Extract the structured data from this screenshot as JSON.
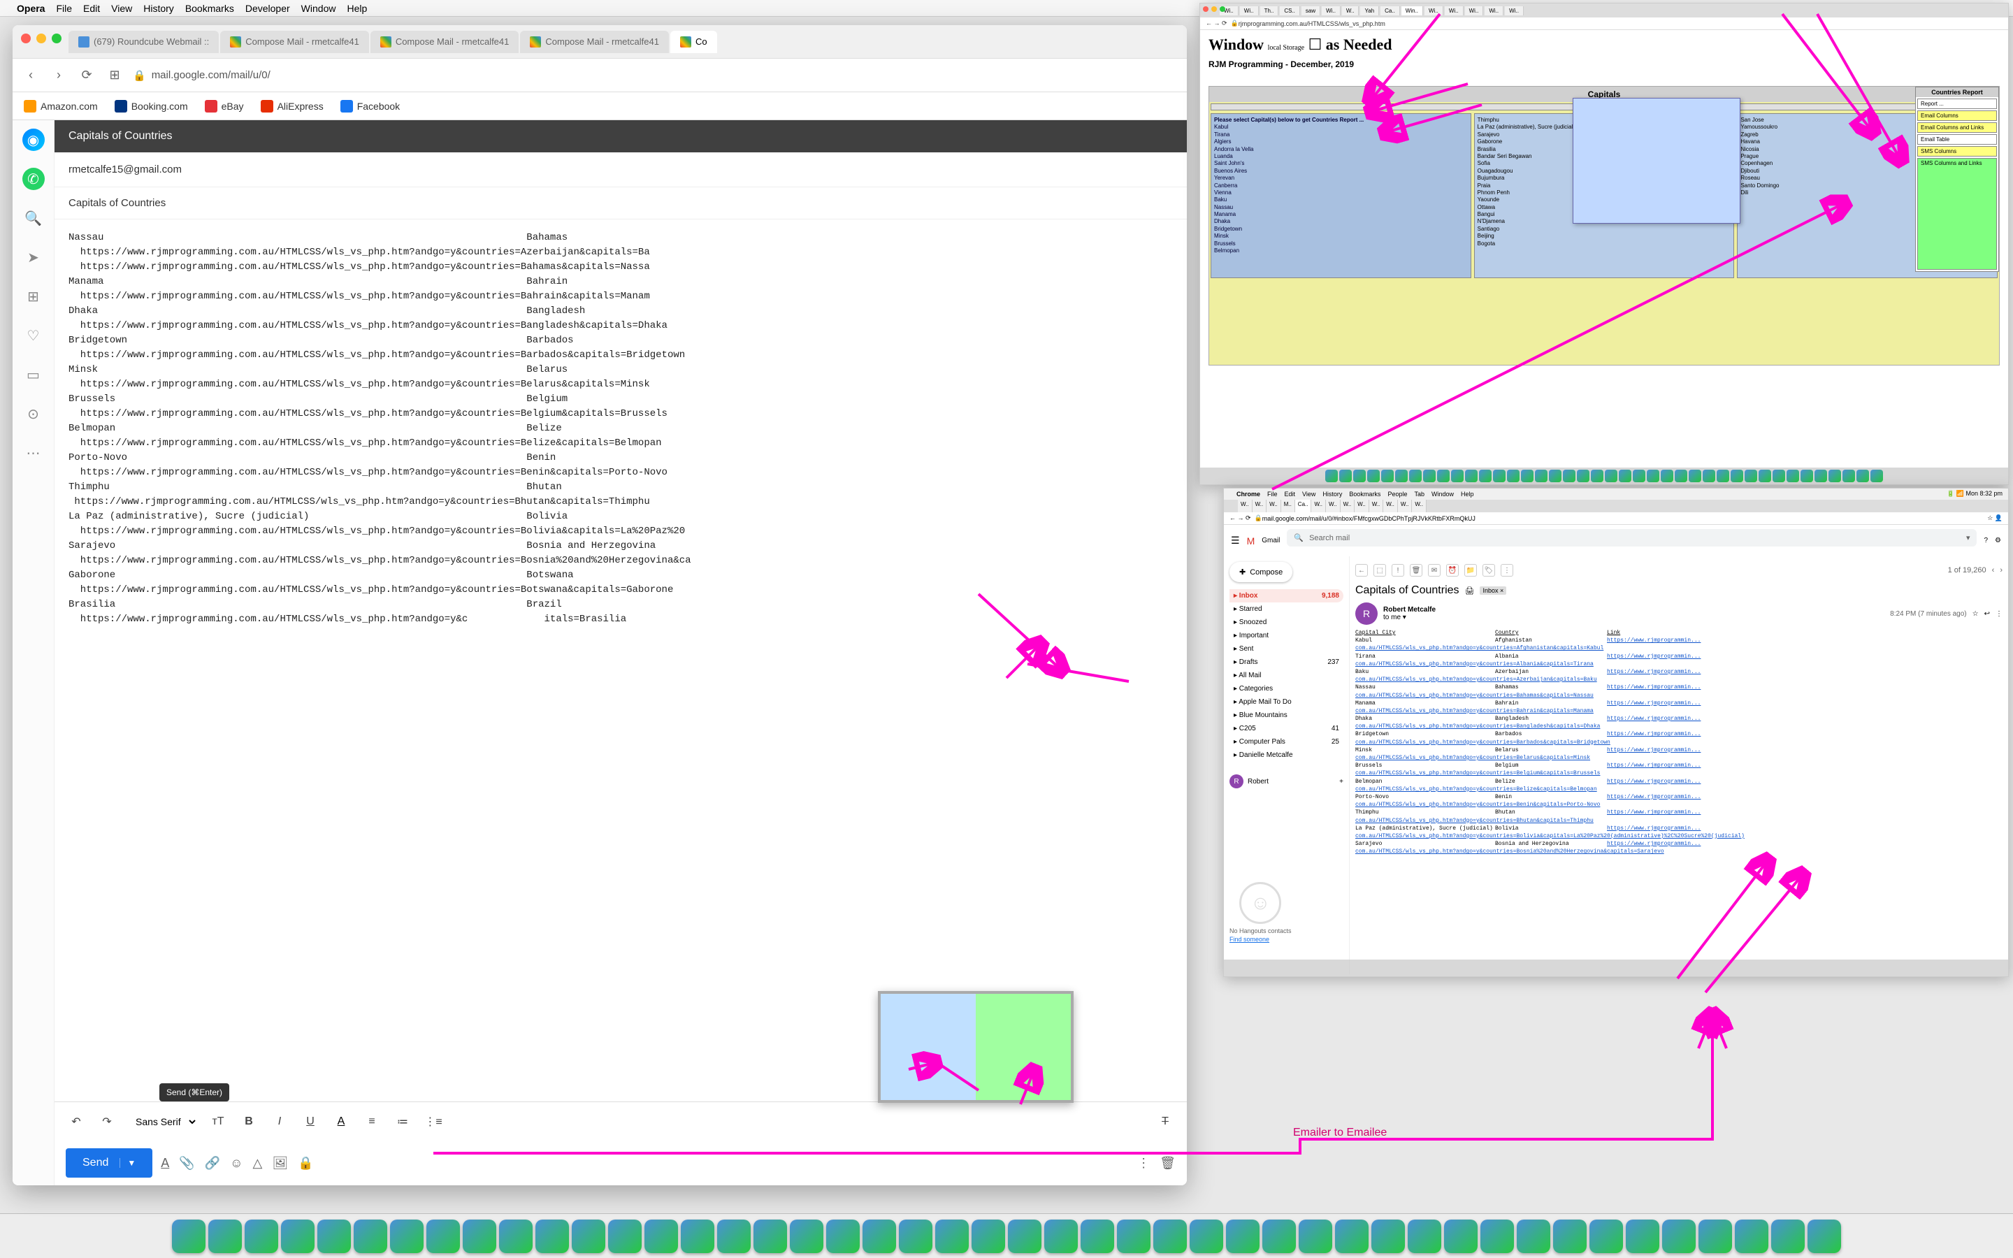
{
  "menubar": {
    "apple": "",
    "app": "Opera",
    "items": [
      "File",
      "Edit",
      "View",
      "History",
      "Bookmarks",
      "Developer",
      "Window",
      "Help"
    ]
  },
  "opera": {
    "tabs": [
      {
        "label": "(679) Roundcube Webmail ::",
        "type": "rc"
      },
      {
        "label": "Compose Mail - rmetcalfe41",
        "type": "gmail"
      },
      {
        "label": "Compose Mail - rmetcalfe41",
        "type": "gmail"
      },
      {
        "label": "Compose Mail - rmetcalfe41",
        "type": "gmail"
      },
      {
        "label": "Co",
        "type": "gmail"
      }
    ],
    "url": "mail.google.com/mail/u/0/",
    "bookmarks": [
      {
        "label": "Amazon.com",
        "color": "#ff9900"
      },
      {
        "label": "Booking.com",
        "color": "#003580"
      },
      {
        "label": "eBay",
        "color": "#e53238"
      },
      {
        "label": "AliExpress",
        "color": "#e62e04"
      },
      {
        "label": "Facebook",
        "color": "#1877f2"
      }
    ]
  },
  "compose": {
    "header": "Capitals of Countries",
    "to": "rmetcalfe15@gmail.com",
    "subject": "Capitals of Countries ",
    "body_lines": [
      "Nassau                                                                        Bahamas",
      "  https://www.rjmprogramming.com.au/HTMLCSS/wls_vs_php.htm?andgo=y&countries=Azerbaijan&capitals=Ba",
      "  https://www.rjmprogramming.com.au/HTMLCSS/wls_vs_php.htm?andgo=y&countries=Bahamas&capitals=Nassa",
      "Manama                                                                        Bahrain",
      "  https://www.rjmprogramming.com.au/HTMLCSS/wls_vs_php.htm?andgo=y&countries=Bahrain&capitals=Manam",
      "Dhaka                                                                         Bangladesh",
      "  https://www.rjmprogramming.com.au/HTMLCSS/wls_vs_php.htm?andgo=y&countries=Bangladesh&capitals=Dhaka",
      "Bridgetown                                                                    Barbados",
      "  https://www.rjmprogramming.com.au/HTMLCSS/wls_vs_php.htm?andgo=y&countries=Barbados&capitals=Bridgetown",
      "Minsk                                                                         Belarus",
      "  https://www.rjmprogramming.com.au/HTMLCSS/wls_vs_php.htm?andgo=y&countries=Belarus&capitals=Minsk",
      "Brussels                                                                      Belgium",
      "  https://www.rjmprogramming.com.au/HTMLCSS/wls_vs_php.htm?andgo=y&countries=Belgium&capitals=Brussels",
      "Belmopan                                                                      Belize",
      "  https://www.rjmprogramming.com.au/HTMLCSS/wls_vs_php.htm?andgo=y&countries=Belize&capitals=Belmopan",
      "Porto-Novo                                                                    Benin",
      "  https://www.rjmprogramming.com.au/HTMLCSS/wls_vs_php.htm?andgo=y&countries=Benin&capitals=Porto-Novo",
      "Thimphu                                                                       Bhutan",
      " https://www.rjmprogramming.com.au/HTMLCSS/wls_vs_php.htm?andgo=y&countries=Bhutan&capitals=Thimphu",
      "La Paz (administrative), Sucre (judicial)                                     Bolivia",
      "  https://www.rjmprogramming.com.au/HTMLCSS/wls_vs_php.htm?andgo=y&countries=Bolivia&capitals=La%20Paz%20",
      "Sarajevo                                                                      Bosnia and Herzegovina",
      "  https://www.rjmprogramming.com.au/HTMLCSS/wls_vs_php.htm?andgo=y&countries=Bosnia%20and%20Herzegovina&ca",
      "Gaborone                                                                      Botswana",
      "  https://www.rjmprogramming.com.au/HTMLCSS/wls_vs_php.htm?andgo=y&countries=Botswana&capitals=Gaborone",
      "Brasilia                                                                      Brazil",
      "  https://www.rjmprogramming.com.au/HTMLCSS/wls_vs_php.htm?andgo=y&c             itals=Brasilia"
    ],
    "font": "Sans Serif",
    "send": "Send",
    "tooltip": "Send (⌘Enter)"
  },
  "smallwin": {
    "url": "rjmprogramming.com.au/HTMLCSS/wls_vs_php.htm",
    "h1a": "Window ",
    "h1b": "local Storage",
    "h1c": " as Needed",
    "h2": "RJM Programming - December, 2019",
    "panel_title": "Capitals",
    "instr": "Please select Capital(s) below to get Countries Report ...",
    "col1": [
      "Kabul",
      "Tirana",
      "Algiers",
      "Andorra la Vella",
      "Luanda",
      "Saint John's",
      "Buenos Aires",
      "Yerevan",
      "Canberra",
      "Vienna",
      "Baku",
      "Nassau",
      "Manama",
      "Dhaka",
      "Bridgetown",
      "Minsk",
      "Brussels",
      "Belmopan"
    ],
    "col2": [
      "Thimphu",
      "La Paz (administrative), Sucre (judicial)",
      "Sarajevo",
      "Gaborone",
      "Brasilia",
      "Bandar Seri Begawan",
      "Sofia",
      "Ouagadougou",
      "Bujumbura",
      "Praia",
      "Phnom Penh",
      "Yaounde",
      "Ottawa",
      "Bangui",
      "N'Djamena",
      "Santiago",
      "Beijing",
      "Bogota"
    ],
    "col3": [
      "San Jose",
      "Yamoussoukro",
      "Zagreb",
      "Havana",
      "Nicosia",
      "Prague",
      "Copenhagen",
      "Djibouti",
      "Roseau",
      "Santo Domingo",
      "Dili"
    ],
    "report_title": "Countries Report",
    "report_btns": [
      "Report ...",
      "Email Columns",
      "Email Columns and Links",
      "Email Table",
      "SMS Columns",
      "SMS Columns and Links"
    ]
  },
  "chromewin": {
    "app": "Chrome",
    "menus": [
      "File",
      "Edit",
      "View",
      "History",
      "Bookmarks",
      "People",
      "Tab",
      "Window",
      "Help"
    ],
    "clock": "Mon 8:32 pm",
    "url": "mail.google.com/mail/u/0/#inbox/FMfcgxwGDbCPhTpjRJVkKRtbFXRmQkUJ",
    "gmail": "Gmail",
    "search_ph": "Search mail",
    "compose": "Compose",
    "folders": [
      {
        "label": "Inbox",
        "count": "9,188",
        "active": true
      },
      {
        "label": "Starred"
      },
      {
        "label": "Snoozed"
      },
      {
        "label": "Important"
      },
      {
        "label": "Sent"
      },
      {
        "label": "Drafts",
        "count": "237"
      },
      {
        "label": "All Mail"
      },
      {
        "label": "Categories"
      },
      {
        "label": "Apple Mail To Do"
      },
      {
        "label": "Blue Mountains"
      },
      {
        "label": "C205",
        "count": "41"
      },
      {
        "label": "Computer Pals",
        "count": "25"
      },
      {
        "label": "Danielle Metcalfe"
      }
    ],
    "counter": "1 of 19,260",
    "subject": "Capitals of Countries",
    "label": "Inbox",
    "from": "Robert Metcalfe",
    "tome": "to me ▾",
    "time": "8:24 PM (7 minutes ago)",
    "headers": {
      "c1": "Capital City",
      "c2": "Country",
      "c3": "Link"
    },
    "rows": [
      {
        "c": "Kabul",
        "n": "Afghanistan"
      },
      {
        "c": "Tirana",
        "n": "Albania"
      },
      {
        "c": "Baku",
        "n": "Azerbaijan"
      },
      {
        "c": "Nassau",
        "n": "Bahamas"
      },
      {
        "c": "Manama",
        "n": "Bahrain"
      },
      {
        "c": "Dhaka",
        "n": "Bangladesh"
      },
      {
        "c": "Bridgetown",
        "n": "Barbados"
      },
      {
        "c": "Minsk",
        "n": "Belarus"
      },
      {
        "c": "Brussels",
        "n": "Belgium"
      },
      {
        "c": "Belmopan",
        "n": "Belize"
      },
      {
        "c": "Porto-Novo",
        "n": "Benin"
      },
      {
        "c": "Thimphu",
        "n": "Bhutan"
      },
      {
        "c": "La Paz (administrative), Sucre (judicial)",
        "n": "Bolivia"
      },
      {
        "c": "Sarajevo",
        "n": "Bosnia and Herzegovina"
      }
    ],
    "linktext": "https://www.rjmprogrammin...",
    "urlprefix": "com.au/HTMLCSS/wls_vs_php.htm?andgo=y&countries=",
    "hangouts_label": "No Hangouts contacts",
    "hangouts_find": "Find someone",
    "robert": "Robert"
  },
  "emailer_label": "Emailer to Emailee",
  "dock_count": 46
}
